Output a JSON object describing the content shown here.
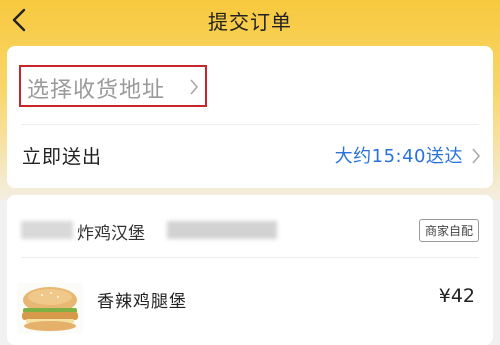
{
  "navbar": {
    "title": "提交订单"
  },
  "address": {
    "placeholder_label": "选择收货地址"
  },
  "delivery": {
    "left_label": "立即送出",
    "eta_label": "大约15:40送达"
  },
  "shop": {
    "name": "炸鸡汉堡",
    "badge": "商家自配"
  },
  "items": [
    {
      "name": "香辣鸡腿堡",
      "price": "¥42"
    }
  ],
  "colors": {
    "accent_yellow": "#f7c93e",
    "link_blue": "#2a73d9",
    "highlight_red": "#c8262b"
  },
  "icons": {
    "back": "chevron-left-icon",
    "forward": "chevron-right-icon"
  }
}
